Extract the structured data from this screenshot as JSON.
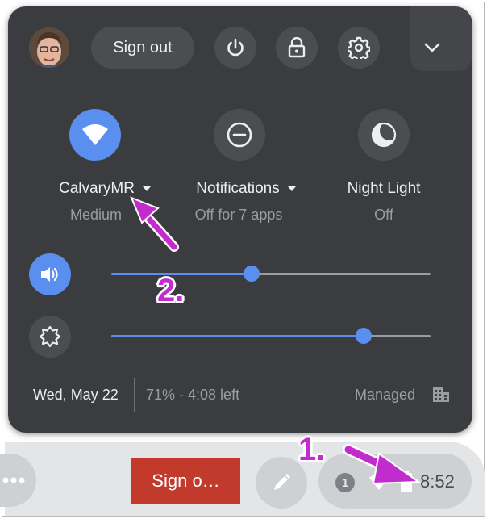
{
  "panel": {
    "sign_out_label": "Sign out",
    "features": [
      {
        "label": "CalvaryMR",
        "sub": "Medium",
        "icon": "wifi-icon",
        "active": true
      },
      {
        "label": "Notifications",
        "sub": "Off for 7 apps",
        "icon": "do-not-disturb-icon",
        "active": false
      },
      {
        "label": "Night Light",
        "sub": "Off",
        "icon": "night-light-icon",
        "active": false
      }
    ],
    "volume_level": 0.44,
    "brightness_level": 0.79,
    "date": "Wed, May 22",
    "battery": "71% - 4:08 left",
    "managed": "Managed"
  },
  "shelf": {
    "sign_out_label": "Sign o…",
    "notification_count": "1",
    "time": "8:52"
  },
  "annotations": {
    "one": "1.",
    "two": "2."
  },
  "colors": {
    "panel_bg": "#3b3c3f",
    "accent": "#5a8ff0",
    "annotation": "#c22ccc",
    "shelf_signout": "#c23a2c"
  }
}
